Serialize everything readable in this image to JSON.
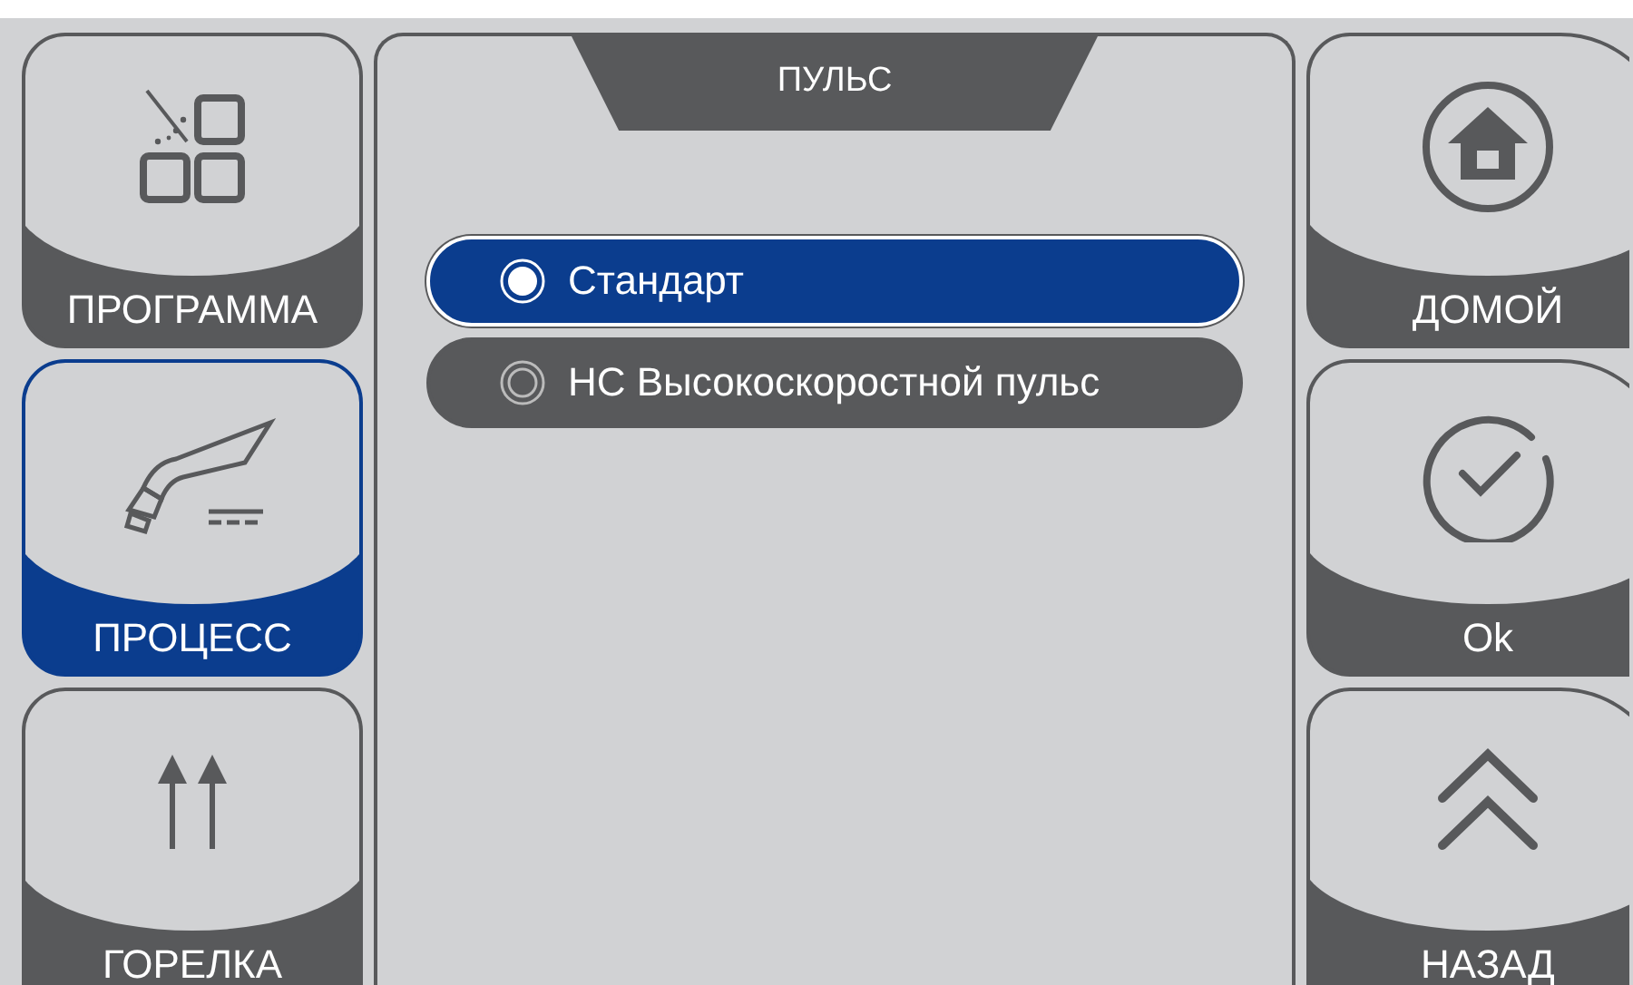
{
  "left_buttons": [
    {
      "label": "ПРОГРАММА",
      "selected": false
    },
    {
      "label": "ПРОЦЕСС",
      "selected": true
    },
    {
      "label": "ГОРЕЛКА",
      "selected": false
    }
  ],
  "panel": {
    "title": "ПУЛЬС",
    "options": [
      {
        "label": "Стандарт",
        "selected": true
      },
      {
        "label": "НС Высокоскоростной пульс",
        "selected": false
      }
    ]
  },
  "right_buttons": [
    {
      "label": "ДОМОЙ"
    },
    {
      "label": "Ok"
    },
    {
      "label": "НАЗАД"
    }
  ]
}
